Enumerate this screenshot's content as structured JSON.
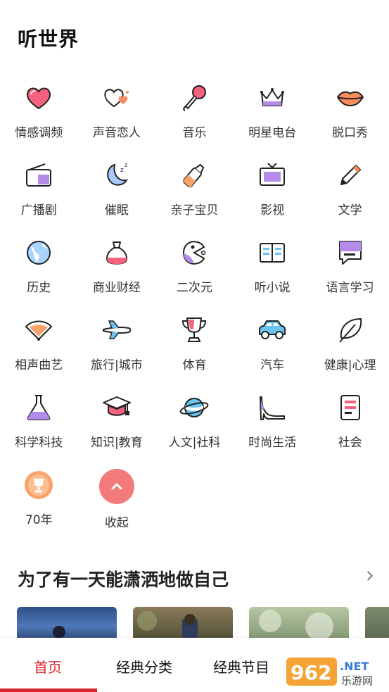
{
  "page": {
    "title": "听世界"
  },
  "categories": [
    {
      "label": "情感调频",
      "icon": "heart-icon"
    },
    {
      "label": "声音恋人",
      "icon": "double-heart-icon"
    },
    {
      "label": "音乐",
      "icon": "microphone-icon"
    },
    {
      "label": "明星电台",
      "icon": "crown-icon"
    },
    {
      "label": "脱口秀",
      "icon": "lips-icon"
    },
    {
      "label": "广播剧",
      "icon": "radio-icon"
    },
    {
      "label": "催眠",
      "icon": "moon-icon"
    },
    {
      "label": "亲子宝贝",
      "icon": "baby-bottle-icon"
    },
    {
      "label": "影视",
      "icon": "tv-icon"
    },
    {
      "label": "文学",
      "icon": "pencil-icon"
    },
    {
      "label": "历史",
      "icon": "globe-icon"
    },
    {
      "label": "商业财经",
      "icon": "money-bag-icon"
    },
    {
      "label": "二次元",
      "icon": "pacman-icon"
    },
    {
      "label": "听小说",
      "icon": "book-icon"
    },
    {
      "label": "语言学习",
      "icon": "speech-bubble-icon"
    },
    {
      "label": "相声曲艺",
      "icon": "fan-icon"
    },
    {
      "label": "旅行|城市",
      "icon": "airplane-icon"
    },
    {
      "label": "体育",
      "icon": "trophy-icon"
    },
    {
      "label": "汽车",
      "icon": "car-icon"
    },
    {
      "label": "健康|心理",
      "icon": "leaf-icon"
    },
    {
      "label": "科学科技",
      "icon": "flask-icon"
    },
    {
      "label": "知识|教育",
      "icon": "graduation-cap-icon"
    },
    {
      "label": "人文|社科",
      "icon": "planet-icon"
    },
    {
      "label": "时尚生活",
      "icon": "high-heel-icon"
    },
    {
      "label": "社会",
      "icon": "document-icon"
    },
    {
      "label": "70年",
      "icon": "medal-icon"
    },
    {
      "label": "收起",
      "icon": "chevron-up-icon"
    }
  ],
  "section": {
    "title": "为了有一天能潇洒地做自己"
  },
  "tabs": [
    {
      "label": "首页"
    },
    {
      "label": "经典分类"
    },
    {
      "label": "经典节目"
    }
  ],
  "watermark": {
    "digits": "962",
    "suffix": ".NET",
    "cn": "乐游网"
  },
  "colors": {
    "accent": "#d7262c",
    "icon_pink": "#f5617f",
    "icon_purple": "#b48be8",
    "collapse": "#f27a7a"
  }
}
